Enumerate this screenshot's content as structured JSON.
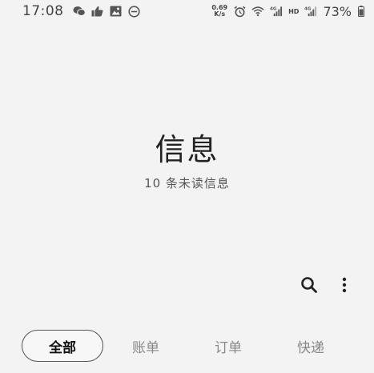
{
  "status_bar": {
    "time": "17:08",
    "net_speed_value": "0.69",
    "net_speed_unit": "K/s",
    "hd_label": "HD",
    "battery_percent": "73%",
    "icons": [
      "wechat-icon",
      "thumbs-up-icon",
      "gallery-icon",
      "do-not-disturb-icon",
      "alarm-icon",
      "wifi-icon",
      "signal-4g-icon",
      "signal-4g-icon-2",
      "battery-icon"
    ]
  },
  "header": {
    "title": "信息",
    "unread": "10 条未读信息"
  },
  "actions": {
    "search": "search-icon",
    "more": "more-vertical-icon"
  },
  "tabs": [
    {
      "label": "全部",
      "active": true
    },
    {
      "label": "账单",
      "active": false
    },
    {
      "label": "订单",
      "active": false
    },
    {
      "label": "快递",
      "active": false
    }
  ],
  "colors": {
    "background": "#f3f3f3",
    "text_primary": "#222222",
    "text_muted": "#888888",
    "active_border": "#555555"
  }
}
